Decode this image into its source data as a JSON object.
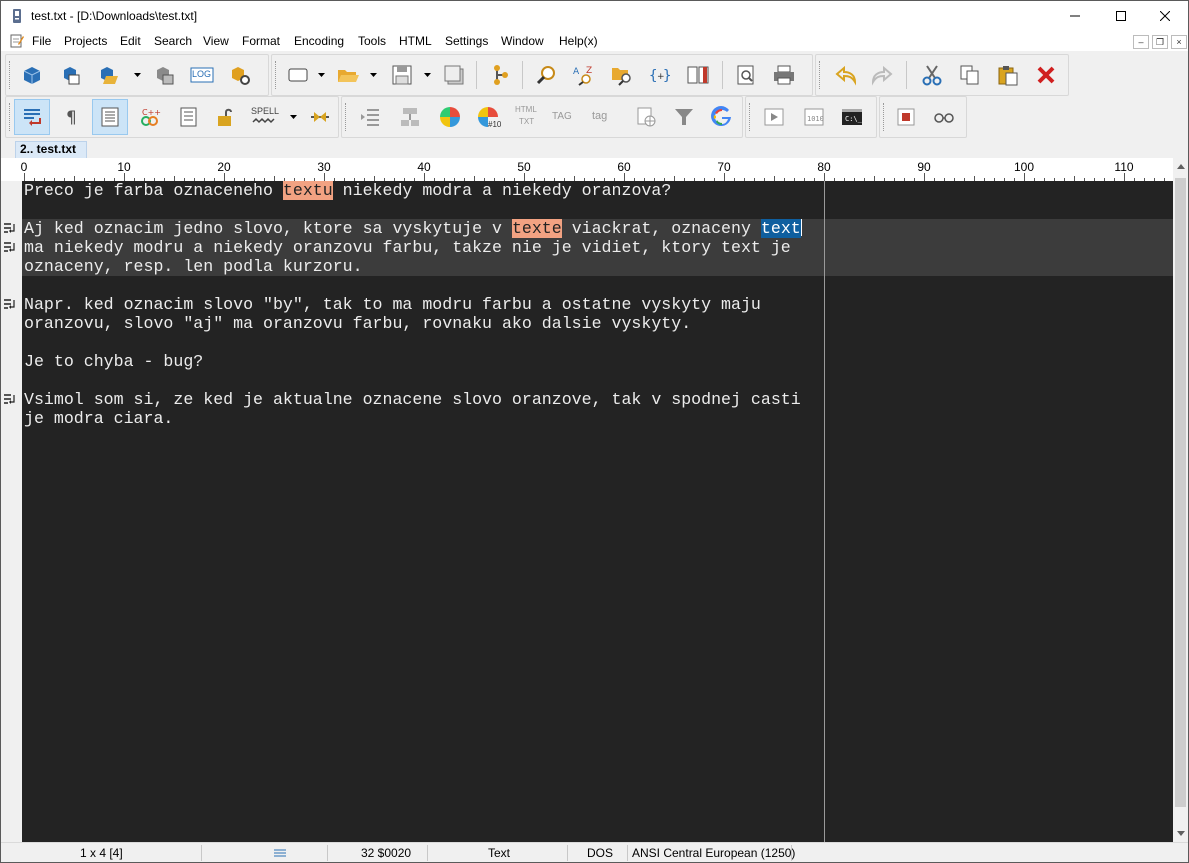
{
  "window": {
    "title": "test.txt - [D:\\Downloads\\test.txt]"
  },
  "menu": [
    "File",
    "Projects",
    "Edit",
    "Search",
    "View",
    "Format",
    "Encoding",
    "Tools",
    "HTML",
    "Settings",
    "Window",
    "Help(x)"
  ],
  "toolbar1": {
    "icons": [
      "new-project-icon",
      "open-project-icon",
      "save-project-icon",
      "project-files-icon",
      "log-icon",
      "project-settings-icon",
      "new-file-icon",
      "open-file-icon",
      "save-file-icon",
      "save-all-icon",
      "tree-icon",
      "find-icon",
      "replace-icon",
      "find-in-files-icon",
      "brackets-icon",
      "book-icon",
      "print-preview-icon",
      "print-icon",
      "undo-icon",
      "redo-icon",
      "cut-icon",
      "copy-icon",
      "paste-icon",
      "delete-icon"
    ],
    "log_label": "LOG"
  },
  "toolbar2": {
    "icons": [
      "word-wrap-icon",
      "pilcrow-icon",
      "line-numbers-icon",
      "syntax-icon",
      "list-icon",
      "lock-icon",
      "spell-icon",
      "spell-dropdown-icon",
      "split-icon",
      "indent-icon",
      "hierarchy-icon",
      "color-wheel-icon",
      "color-picker-icon",
      "html-txt-icon",
      "tag-close-icon",
      "tag-open-icon",
      "web-page-icon",
      "filter-icon",
      "google-icon",
      "play-icon",
      "binary-icon",
      "terminal-icon",
      "stop-icon",
      "glasses-icon"
    ],
    "spell_label": "SPELL",
    "html_label": "HTML",
    "txt_label": "TXT",
    "tag_label": "TAG",
    "tag2_label": "tag",
    "color_label": "#10"
  },
  "tabs": [
    {
      "label": "2.. test.txt",
      "active": true
    }
  ],
  "ruler": {
    "ticks": [
      "0",
      "10",
      "20",
      "30",
      "40",
      "50",
      "60",
      "70",
      "80",
      "90",
      "100",
      "110"
    ]
  },
  "editor": {
    "lines": [
      [
        {
          "t": "Preco je farba oznaceneho "
        },
        {
          "t": "textu",
          "hl": "orange"
        },
        {
          "t": " niekedy modra a niekedy oranzova?"
        }
      ],
      [],
      [
        {
          "t": "Aj ked oznacim jedno slovo, ktore sa vyskytuje v "
        },
        {
          "t": "texte",
          "hl": "orange"
        },
        {
          "t": " viackrat, oznaceny "
        },
        {
          "t": "text",
          "hl": "blue"
        },
        {
          "caret": true
        }
      ],
      [
        {
          "t": "ma niekedy modru a niekedy oranzovu farbu, takze nie je vidiet, ktory text je"
        }
      ],
      [
        {
          "t": "oznaceny, resp. len podla kurzoru."
        }
      ],
      [],
      [
        {
          "t": "Napr. ked oznacim slovo \"by\", tak to ma modru farbu a ostatne vyskyty maju"
        }
      ],
      [
        {
          "t": "oranzovu, slovo \"aj\" ma oranzovu farbu, rovnaku ako dalsie vyskyty."
        }
      ],
      [],
      [
        {
          "t": "Je to chyba - bug?"
        }
      ],
      [],
      [
        {
          "t": "Vsimol som si, ze ked je aktualne oznacene slovo oranzove, tak v spodnej casti"
        }
      ],
      [
        {
          "t": "je modra ciara."
        }
      ]
    ],
    "wrap_marker_lines": [
      3,
      4,
      7,
      12
    ],
    "colors": {
      "background": "#232323",
      "text": "#ececec",
      "highlight_orange": "#f2a282",
      "highlight_blue": "#0f5f9f",
      "current_line": "#3c3c3c"
    }
  },
  "status": {
    "position": "1 x 4  [4]",
    "char": "32  $0020",
    "mode": "Text",
    "line_ending": "DOS",
    "encoding": "ANSI Central European (1250)"
  }
}
